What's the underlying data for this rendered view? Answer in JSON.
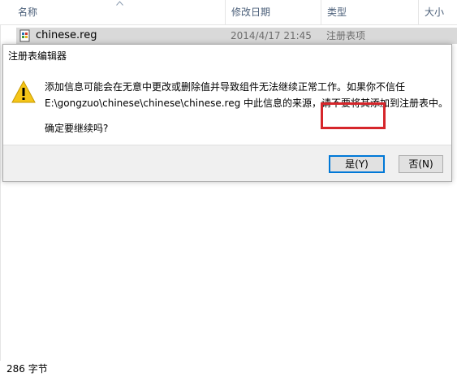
{
  "columns": {
    "name": "名称",
    "date": "修改日期",
    "type": "类型",
    "size": "大小"
  },
  "file": {
    "name": "chinese.reg",
    "date": "2014/4/17 21:45",
    "type": "注册表项",
    "icon": "registry-file-icon"
  },
  "dialog": {
    "title": "注册表编辑器",
    "message_line1": "添加信息可能会在无意中更改或删除值并导致组件无法继续正常工作。如果你不信任",
    "message_line2": "E:\\gongzuo\\chinese\\chinese\\chinese.reg 中此信息的来源，请不要将其添加到注册表中。",
    "confirm": "确定要继续吗?",
    "yes_label": "是(Y)",
    "no_label": "否(N)",
    "icon": "warning-icon"
  },
  "status": {
    "size_text": "286 字节"
  },
  "colors": {
    "highlight": "#d6262b",
    "focus_border": "#0078d7",
    "warning": "#f5c518"
  }
}
